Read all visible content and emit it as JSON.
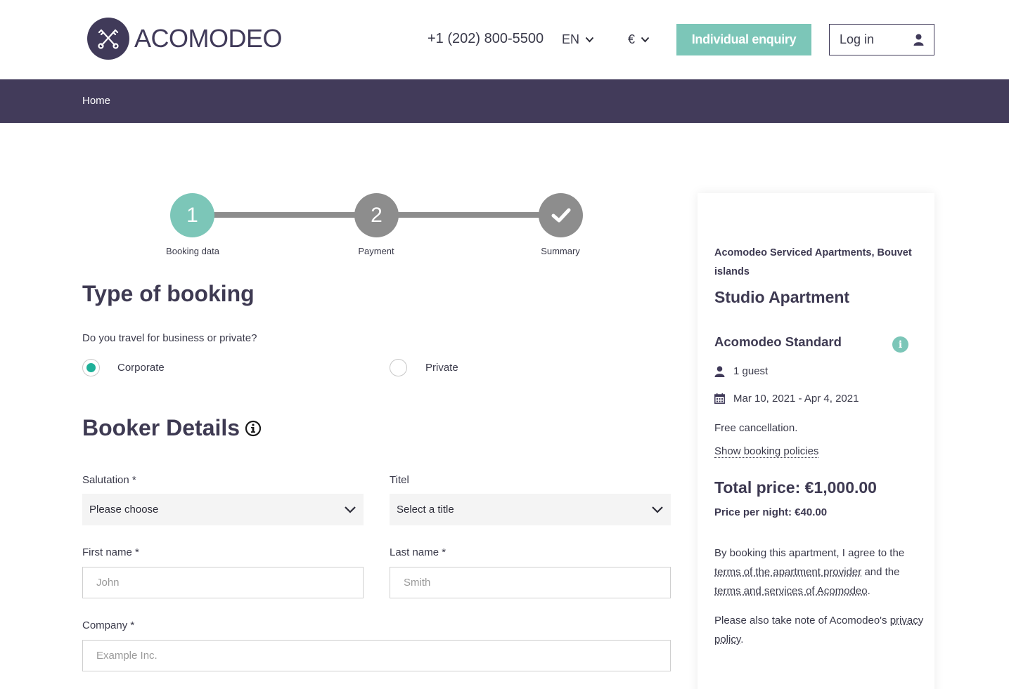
{
  "header": {
    "logo_text": "ACOMODEO",
    "phone": "+1 (202) 800-5500",
    "language": "EN",
    "currency": "€",
    "enquiry_label": "Individual enquiry",
    "login_label": "Log in"
  },
  "nav": {
    "home": "Home"
  },
  "stepper": {
    "steps": [
      {
        "number": "1",
        "label": "Booking data"
      },
      {
        "number": "2",
        "label": "Payment"
      },
      {
        "number": "",
        "label": "Summary"
      }
    ]
  },
  "booking_type": {
    "title": "Type of booking",
    "question": "Do you travel for business or private?",
    "options": [
      "Corporate",
      "Private"
    ],
    "selected": "Corporate"
  },
  "booker": {
    "title": "Booker Details",
    "salutation_label": "Salutation *",
    "salutation_value": "Please choose",
    "title_label": "Titel",
    "title_value": "Select a title",
    "first_name_label": "First name *",
    "first_name_placeholder": "John",
    "last_name_label": "Last name *",
    "last_name_placeholder": "Smith",
    "company_label": "Company *",
    "company_placeholder": "Example Inc."
  },
  "summary": {
    "property": "Acomodeo Serviced Apartments, Bouvet islands",
    "apartment_type": "Studio Apartment",
    "rate": "Acomodeo Standard",
    "guests": "1 guest",
    "dates": "Mar 10, 2021 - Apr 4, 2021",
    "cancellation": "Free cancellation.",
    "policies_link": "Show booking policies",
    "total_price": "Total price: €1,000.00",
    "price_per_night": "Price per night: €40.00",
    "terms_prefix": "By booking this apartment, I agree to the",
    "terms_provider_link": "terms of the apartment provider",
    "terms_and": "and the",
    "terms_acomodeo_link": "terms and services of Acomodeo",
    "terms_suffix": ".",
    "privacy_prefix": "Please also take note of Acomodeo's",
    "privacy_link": "privacy policy",
    "privacy_suffix": "."
  },
  "colors": {
    "brand_dark": "#423b5a",
    "accent_teal": "#7cc6b8",
    "radio_green": "#1fb099",
    "step_gray": "#8d8d8d"
  }
}
